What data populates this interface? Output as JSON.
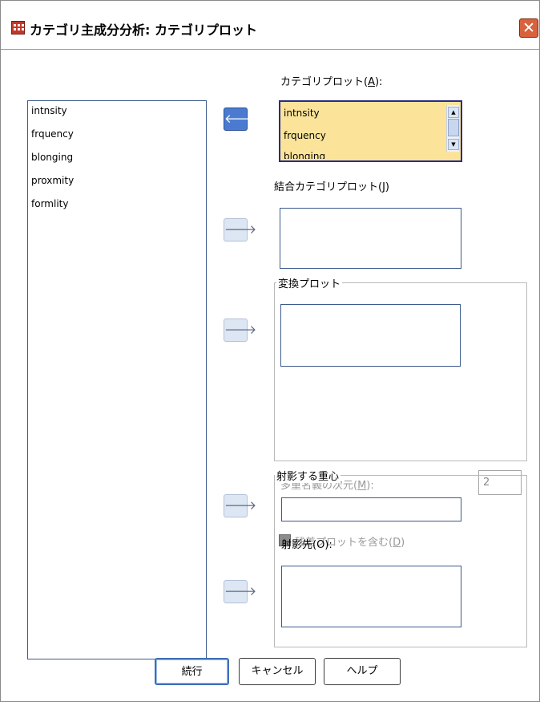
{
  "window": {
    "title": "カテゴリ主成分分析: カテゴリプロット",
    "close_symbol": "✕"
  },
  "source_list": {
    "items": [
      "intnsity",
      "frquency",
      "blonging",
      "proxmity",
      "formlity"
    ]
  },
  "category_plots": {
    "label_prefix": "カテゴリプロット(",
    "mnemonic": "A",
    "label_suffix": "):",
    "items": [
      "intnsity",
      "frquency",
      "blonging"
    ]
  },
  "joint_category_plots": {
    "label_prefix": "結合カテゴリプロット(",
    "mnemonic": "J",
    "label_suffix": ")"
  },
  "transformation_plots": {
    "group_title": "変換プロット",
    "dimensions_label_prefix": "多重名義の次元(",
    "dimensions_mnemonic": "M",
    "dimensions_label_suffix": "):",
    "dimensions_value": "2",
    "include_residuals_prefix": "残差プロットを含む(",
    "include_residuals_mnemonic": "D",
    "include_residuals_suffix": ")"
  },
  "projected_centroids": {
    "group_title": "射影する重心",
    "onto_label": "射影先(O):"
  },
  "buttons": {
    "continue": "続行",
    "cancel": "キャンセル",
    "help": "ヘルプ"
  },
  "icons": {
    "move_left": "move-left-arrow",
    "move_right": "move-right-arrow",
    "app": "spss-table-icon"
  },
  "colors": {
    "accent": "#4a7bd0",
    "selected_list_bg": "#fbe49a",
    "close_button": "#d9623c"
  }
}
